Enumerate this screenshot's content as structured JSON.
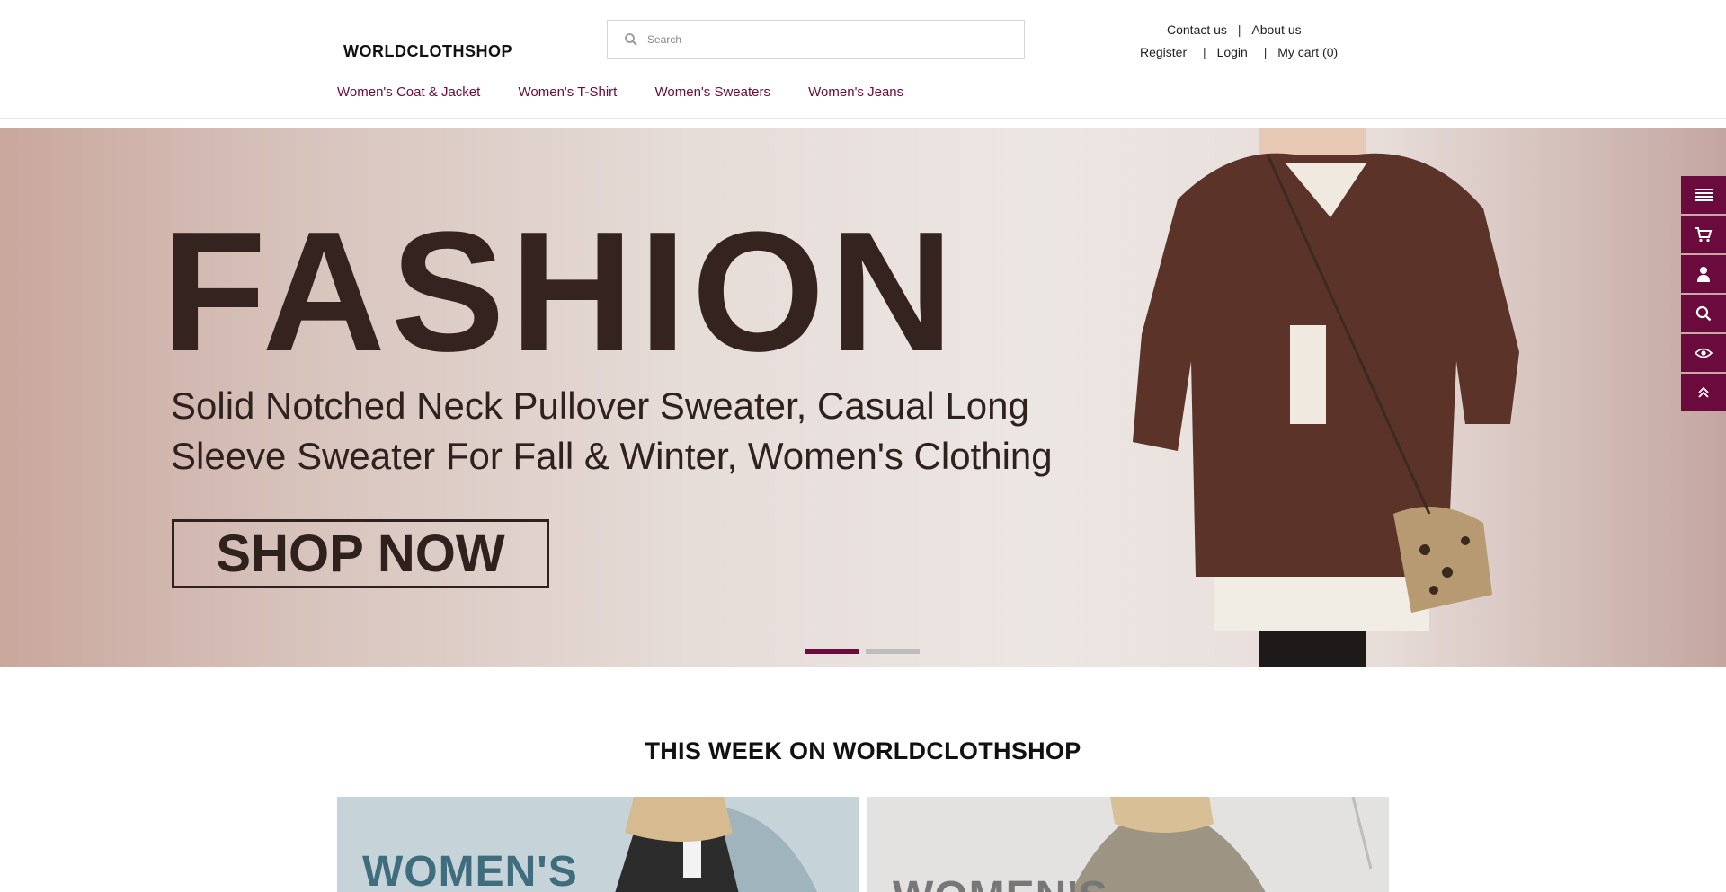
{
  "header": {
    "logo": "WORLDCLOTHSHOP",
    "search_placeholder": "Search",
    "contact": "Contact us",
    "about": "About us",
    "register": "Register",
    "login": "Login",
    "cart": "My cart",
    "cart_count": "(0)"
  },
  "nav": {
    "items": [
      {
        "label": "Women's Coat & Jacket"
      },
      {
        "label": "Women's T-Shirt"
      },
      {
        "label": "Women's Sweaters"
      },
      {
        "label": "Women's Jeans"
      }
    ]
  },
  "hero": {
    "title": "FASHION",
    "subtitle": "Solid Notched Neck Pullover Sweater, Casual Long Sleeve Sweater For Fall & Winter, Women's Clothing",
    "cta": "SHOP NOW",
    "slides": 2,
    "active_slide": 1
  },
  "section": {
    "title": "THIS WEEK ON WORLDCLOTHSHOP",
    "cards": [
      {
        "label": "WOMEN'S"
      },
      {
        "label": "WOMEN'S"
      }
    ]
  },
  "colors": {
    "accent": "#6b0a3c",
    "hero_text": "#35231f"
  },
  "icons": {
    "sidebar": [
      "menu-icon",
      "cart-icon",
      "user-icon",
      "search-icon",
      "eye-icon",
      "chevron-up-double-icon"
    ]
  }
}
